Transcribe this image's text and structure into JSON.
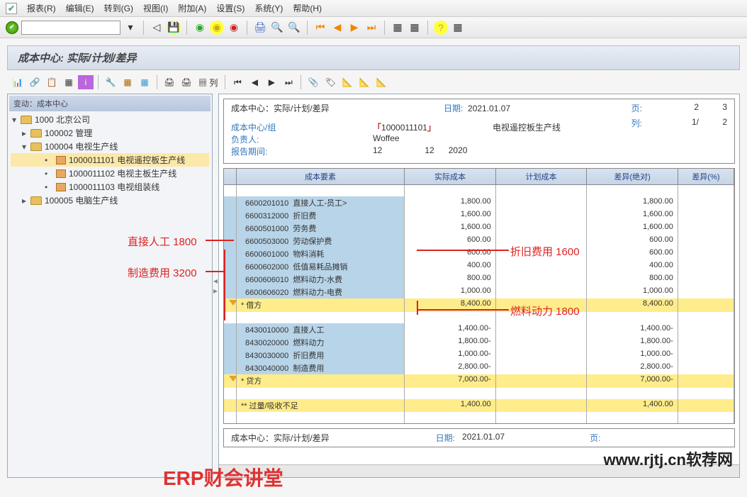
{
  "menubar": {
    "items": [
      "报表(R)",
      "编辑(E)",
      "转到(G)",
      "视图(I)",
      "附加(A)",
      "设置(S)",
      "系统(Y)",
      "帮助(H)"
    ]
  },
  "title": "成本中心: 实际/计划/差异",
  "toolbar2_label": "列",
  "tree": {
    "header": "变动：成本中心",
    "root": "1000 北京公司",
    "n1": "100002 管理",
    "n2": "100004 电视生产线",
    "n2a": "1000011101 电视遥控板生产线",
    "n2b": "1000011102 电视主板生产线",
    "n2c": "1000011103 电视组装线",
    "n3": "100005 电脑生产线"
  },
  "report": {
    "title_lbl": "成本中心：实际/计划/差异",
    "date_lbl": "日期:",
    "date_val": "2021.01.07",
    "page_lbl": "页:",
    "page_from": "2",
    "page_to": "3",
    "col_lbl": "列:",
    "col_from": "1/",
    "col_to": "2",
    "cc_lbl": "成本中心/组",
    "cc_val": "1000011101",
    "cc_desc": "电视遥控板生产线",
    "resp_lbl": "负责人:",
    "resp_val": "Woffee",
    "period_lbl": "报告期间:",
    "period_from": "12",
    "period_to": "12",
    "period_year": "2020"
  },
  "columns": {
    "c0": "成本要素",
    "c1": "实际成本",
    "c2": "计划成本",
    "c3": "差异(绝对)",
    "c4": "差异(%)"
  },
  "rows": [
    {
      "code": "6600201010",
      "name": "直接人工-员工>",
      "act": "1,800.00",
      "var": "1,800.00"
    },
    {
      "code": "6600312000",
      "name": "折旧费",
      "act": "1,600.00",
      "var": "1,600.00"
    },
    {
      "code": "6600501000",
      "name": "劳务费",
      "act": "1,600.00",
      "var": "1,600.00"
    },
    {
      "code": "6600503000",
      "name": "劳动保护费",
      "act": "600.00",
      "var": "600.00"
    },
    {
      "code": "6600601000",
      "name": "物料消耗",
      "act": "600.00",
      "var": "600.00"
    },
    {
      "code": "6600602000",
      "name": "低值易耗品摊销",
      "act": "400.00",
      "var": "400.00"
    },
    {
      "code": "6600606010",
      "name": "燃料动力-水费",
      "act": "800.00",
      "var": "800.00"
    },
    {
      "code": "6600606020",
      "name": "燃料动力-电费",
      "act": "1,000.00",
      "var": "1,000.00"
    }
  ],
  "debit": {
    "label": "* 借方",
    "act": "8,400.00",
    "var": "8,400.00"
  },
  "rows2": [
    {
      "code": "8430010000",
      "name": "直接人工",
      "act": "1,400.00-",
      "var": "1,400.00-"
    },
    {
      "code": "8430020000",
      "name": "燃料动力",
      "act": "1,800.00-",
      "var": "1,800.00-"
    },
    {
      "code": "8430030000",
      "name": "折旧费用",
      "act": "1,000.00-",
      "var": "1,000.00-"
    },
    {
      "code": "8430040000",
      "name": "制造费用",
      "act": "2,800.00-",
      "var": "2,800.00-"
    }
  ],
  "credit": {
    "label": "* 贷方",
    "act": "7,000.00-",
    "var": "7,000.00-"
  },
  "over": {
    "label": "** 过量/吸收不足",
    "act": "1,400.00",
    "var": "1,400.00"
  },
  "footer": {
    "title": "成本中心：实际/计划/差异",
    "date_lbl": "日期:",
    "date_val": "2021.01.07",
    "page_lbl": "页:"
  },
  "annotations": {
    "a1": "直接人工 1800",
    "a2": "制造费用 3200",
    "a3": "折旧费用 1600",
    "a4": "燃料动力 1800"
  },
  "watermark1": "ERP财会讲堂",
  "watermark2": "www.rjtj.cn软荐网"
}
